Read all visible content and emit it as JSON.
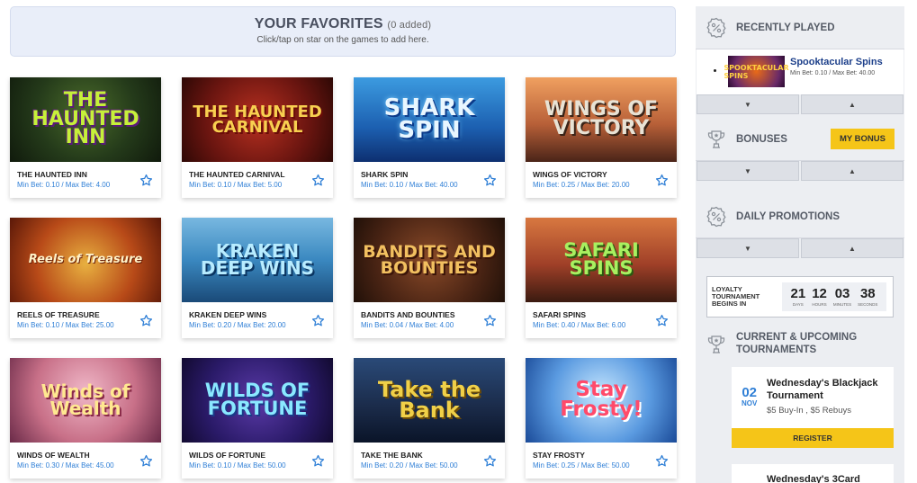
{
  "favorites": {
    "title": "YOUR FAVORITES",
    "count": "(0 added)",
    "subtitle": "Click/tap on star on the games to add here."
  },
  "games": [
    {
      "name": "THE HAUNTED INN",
      "art": "The Haunted Inn",
      "bet": "Min Bet: 0.10 / Max Bet: 4.00",
      "theme": "t-haunted"
    },
    {
      "name": "THE HAUNTED CARNIVAL",
      "art": "The Haunted Carnival",
      "bet": "Min Bet: 0.10 / Max Bet: 5.00",
      "theme": "t-carnival"
    },
    {
      "name": "SHARK SPIN",
      "art": "Shark Spin",
      "bet": "Min Bet: 0.10 / Max Bet: 40.00",
      "theme": "t-shark"
    },
    {
      "name": "WINGS OF VICTORY",
      "art": "Wings of Victory",
      "bet": "Min Bet: 0.25 / Max Bet: 20.00",
      "theme": "t-wings"
    },
    {
      "name": "REELS OF TREASURE",
      "art": "Reels of Treasure",
      "bet": "Min Bet: 0.10 / Max Bet: 25.00",
      "theme": "t-reels"
    },
    {
      "name": "KRAKEN DEEP WINS",
      "art": "Kraken Deep Wins",
      "bet": "Min Bet: 0.20 / Max Bet: 20.00",
      "theme": "t-kraken"
    },
    {
      "name": "BANDITS AND BOUNTIES",
      "art": "Bandits and Bounties",
      "bet": "Min Bet: 0.04 / Max Bet: 4.00",
      "theme": "t-bandits"
    },
    {
      "name": "SAFARI SPINS",
      "art": "Safari Spins",
      "bet": "Min Bet: 0.40 / Max Bet: 6.00",
      "theme": "t-safari"
    },
    {
      "name": "WINDS OF WEALTH",
      "art": "Winds of Wealth",
      "bet": "Min Bet: 0.30 / Max Bet: 45.00",
      "theme": "t-winds"
    },
    {
      "name": "WILDS OF FORTUNE",
      "art": "Wilds of Fortune",
      "bet": "Min Bet: 0.10 / Max Bet: 50.00",
      "theme": "t-fortune"
    },
    {
      "name": "TAKE THE BANK",
      "art": "Take the Bank",
      "bet": "Min Bet: 0.20 / Max Bet: 50.00",
      "theme": "t-bank"
    },
    {
      "name": "STAY FROSTY",
      "art": "Stay Frosty!",
      "bet": "Min Bet: 0.25 / Max Bet: 50.00",
      "theme": "t-frosty"
    }
  ],
  "sidebar": {
    "recently_played": {
      "title": "RECENTLY PLAYED",
      "game_name": "Spooktacular Spins",
      "game_art": "SPOOKTACULAR SPINS",
      "game_bet": "Min Bet: 0.10 / Max Bet: 40.00"
    },
    "bonuses": {
      "title": "BONUSES",
      "my_bonus_label": "MY BONUS"
    },
    "daily_promotions": {
      "title": "DAILY PROMOTIONS"
    },
    "loyalty": {
      "label": "LOYALTY TOURNAMENT BEGINS IN",
      "days": "21",
      "days_label": "DAYS",
      "hours": "12",
      "hours_label": "HOURS",
      "minutes": "03",
      "minutes_label": "MINUTES",
      "seconds": "38",
      "seconds_label": "SECONDS"
    },
    "tournaments": {
      "title": "CURRENT & UPCOMING TOURNAMENTS",
      "items": [
        {
          "day": "02",
          "month": "NOV",
          "name": "Wednesday's Blackjack Tournament",
          "buyin": "$5 Buy-In , $5 Rebuys",
          "register_label": "REGISTER"
        },
        {
          "name": "Wednesday's 3Card"
        }
      ]
    }
  },
  "colors": {
    "accent_blue": "#2f7fd6",
    "accent_yellow": "#f5c518",
    "sidebar_bg": "#eceef2"
  }
}
